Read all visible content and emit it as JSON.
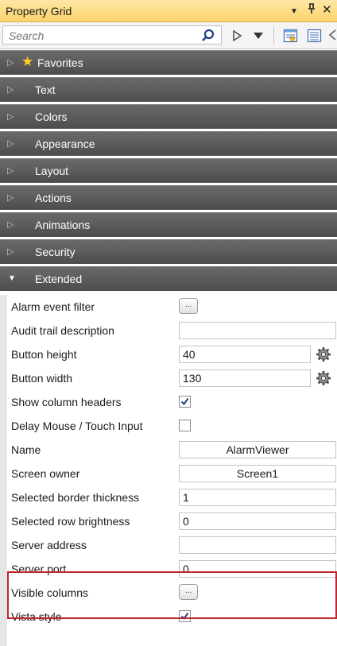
{
  "window": {
    "title": "Property Grid",
    "pin_glyph": "ᛘ",
    "close_glyph": "✕",
    "dropdown_glyph": "▼"
  },
  "search": {
    "placeholder": "Search",
    "value": ""
  },
  "toolbar": {
    "icons": [
      "search-icon",
      "play-outline-icon",
      "dropdown-triangle-icon",
      "categorized-view-icon",
      "list-view-icon"
    ]
  },
  "categories": [
    {
      "label": "Favorites",
      "expanded": false,
      "starred": true
    },
    {
      "label": "Text",
      "expanded": false
    },
    {
      "label": "Colors",
      "expanded": false
    },
    {
      "label": "Appearance",
      "expanded": false
    },
    {
      "label": "Layout",
      "expanded": false
    },
    {
      "label": "Actions",
      "expanded": false
    },
    {
      "label": "Animations",
      "expanded": false
    },
    {
      "label": "Security",
      "expanded": false
    },
    {
      "label": "Extended",
      "expanded": true
    }
  ],
  "properties": [
    {
      "name": "Alarm event filter",
      "kind": "ellipsis",
      "button": "..."
    },
    {
      "name": "Audit trail description",
      "kind": "text",
      "value": ""
    },
    {
      "name": "Button height",
      "kind": "number",
      "value": "40",
      "gear": true
    },
    {
      "name": "Button width",
      "kind": "number",
      "value": "130",
      "gear": true
    },
    {
      "name": "Show column headers",
      "kind": "checkbox",
      "checked": true
    },
    {
      "name": "Delay Mouse / Touch Input",
      "kind": "checkbox",
      "checked": false
    },
    {
      "name": "Name",
      "kind": "text",
      "value": "AlarmViewer",
      "centered": true
    },
    {
      "name": "Screen owner",
      "kind": "text",
      "value": "Screen1",
      "centered": true
    },
    {
      "name": "Selected border thickness",
      "kind": "text",
      "value": "1"
    },
    {
      "name": "Selected row brightness",
      "kind": "text",
      "value": "0"
    },
    {
      "name": "Server address",
      "kind": "text",
      "value": ""
    },
    {
      "name": "Server port",
      "kind": "text",
      "value": "0"
    },
    {
      "name": "Visible columns",
      "kind": "ellipsis",
      "button": "..."
    },
    {
      "name": "Vista style",
      "kind": "checkbox",
      "checked": true
    }
  ],
  "colors": {
    "title_bar": "#fbd36a",
    "category_header": "#5a5a5a",
    "highlight_border": "#c0282d",
    "star": "#ffd21f"
  }
}
